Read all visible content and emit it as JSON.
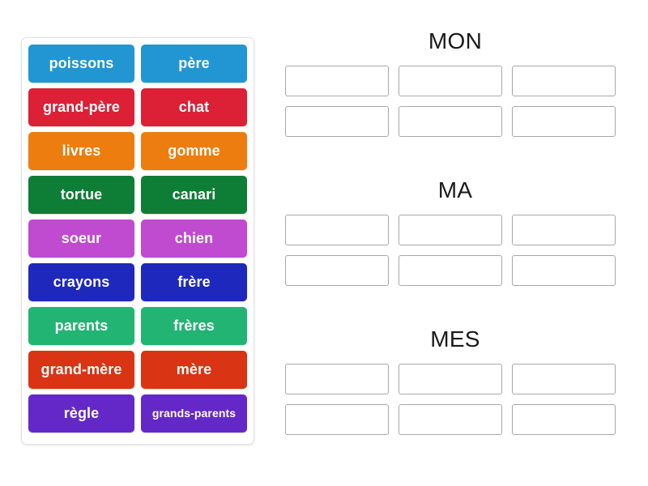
{
  "activity": {
    "type": "group-sort",
    "background_color": "#ffffff"
  },
  "tiles_panel": {
    "name": "word-tiles-panel",
    "rows": [
      {
        "color": "#2196d3",
        "left": {
          "label": "poissons"
        },
        "right": {
          "label": "père"
        }
      },
      {
        "color": "#dc2036",
        "left": {
          "label": "grand-père"
        },
        "right": {
          "label": "chat"
        }
      },
      {
        "color": "#ed7d0e",
        "left": {
          "label": "livres"
        },
        "right": {
          "label": "gomme"
        }
      },
      {
        "color": "#0e7e36",
        "left": {
          "label": "tortue"
        },
        "right": {
          "label": "canari"
        }
      },
      {
        "color": "#c04ad0",
        "left": {
          "label": "soeur"
        },
        "right": {
          "label": "chien"
        }
      },
      {
        "color": "#1f28bc",
        "left": {
          "label": "crayons"
        },
        "right": {
          "label": "frère"
        }
      },
      {
        "color": "#22b473",
        "left": {
          "label": "parents"
        },
        "right": {
          "label": "frères"
        }
      },
      {
        "color": "#d93413",
        "left": {
          "label": "grand-mère"
        },
        "right": {
          "label": "mère"
        }
      },
      {
        "color": "#6428c8",
        "left": {
          "label": "règle"
        },
        "right": {
          "label": "grands-parents",
          "small": true
        }
      }
    ]
  },
  "categories": [
    {
      "title": "MON",
      "slots": [
        "",
        "",
        "",
        "",
        "",
        ""
      ]
    },
    {
      "title": "MA",
      "slots": [
        "",
        "",
        "",
        "",
        "",
        ""
      ]
    },
    {
      "title": "MES",
      "slots": [
        "",
        "",
        "",
        "",
        "",
        ""
      ]
    }
  ]
}
